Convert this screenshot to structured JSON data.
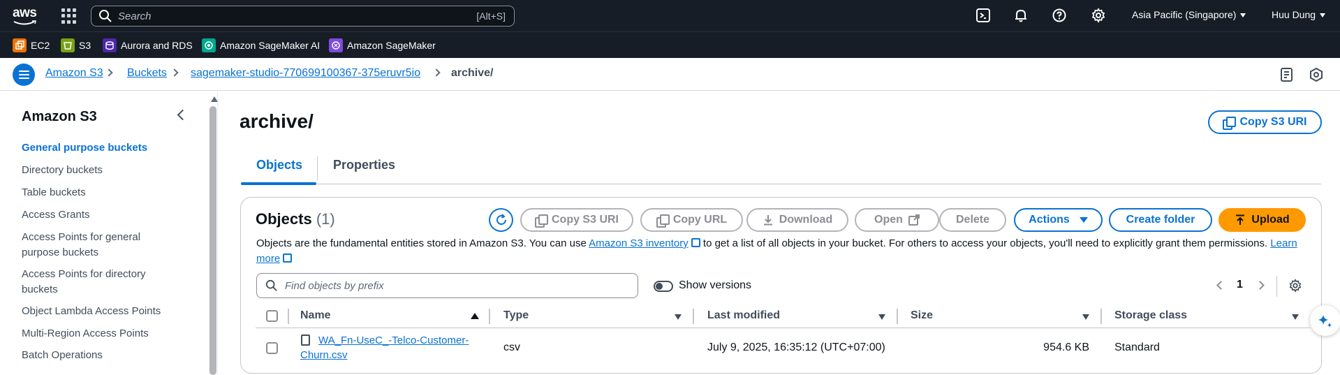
{
  "topnav": {
    "logo_text": "aws",
    "search_placeholder": "Search",
    "search_shortcut": "[Alt+S]",
    "region": "Asia Pacific (Singapore)",
    "user": "Huu Dung",
    "icons": [
      "cloudshell-icon",
      "bell-icon",
      "help-icon",
      "gear-icon"
    ]
  },
  "favorites": [
    {
      "label": "EC2",
      "color": "#ed7100"
    },
    {
      "label": "S3",
      "color": "#7aa116"
    },
    {
      "label": "Aurora and RDS",
      "color": "#4d27aa"
    },
    {
      "label": "Amazon SageMaker AI",
      "color": "#01a88d"
    },
    {
      "label": "Amazon SageMaker",
      "color": "#7d4cdb"
    }
  ],
  "breadcrumb": [
    "Amazon S3",
    "Buckets",
    "sagemaker-studio-770699100367-375eruvr5io",
    "archive/"
  ],
  "sidebar": {
    "title": "Amazon S3",
    "items": [
      "General purpose buckets",
      "Directory buckets",
      "Table buckets",
      "Access Grants",
      "Access Points for general purpose buckets",
      "Access Points for directory buckets",
      "Object Lambda Access Points",
      "Multi-Region Access Points",
      "Batch Operations"
    ]
  },
  "main": {
    "title": "archive/",
    "copy_uri_label": "Copy S3 URI",
    "tabs": [
      "Objects",
      "Properties"
    ],
    "objects": {
      "title": "Objects",
      "count": "(1)",
      "buttons": {
        "copy_uri": "Copy S3 URI",
        "copy_url": "Copy URL",
        "download": "Download",
        "open": "Open",
        "delete": "Delete",
        "actions": "Actions",
        "create_folder": "Create folder",
        "upload": "Upload"
      },
      "desc_1": "Objects are the fundamental entities stored in Amazon S3. You can use",
      "desc_link": "Amazon S3 inventory",
      "desc_2": "to get a list of all objects in your bucket. For others to access your objects, you'll need to explicitly grant them permissions.",
      "learn_more": "Learn more",
      "filter_placeholder": "Find objects by prefix",
      "show_versions": "Show versions",
      "page": "1",
      "columns": [
        "Name",
        "Type",
        "Last modified",
        "Size",
        "Storage class"
      ],
      "rows": [
        {
          "name": "WA_Fn-UseC_-Telco-Customer-Churn.csv",
          "type": "csv",
          "last_modified": "July 9, 2025, 16:35:12 (UTC+07:00)",
          "size": "954.6 KB",
          "storage_class": "Standard"
        }
      ]
    }
  }
}
